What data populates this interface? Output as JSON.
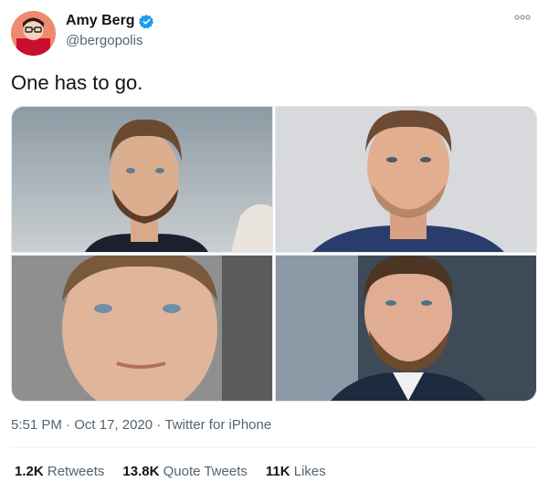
{
  "author": {
    "name": "Amy Berg",
    "handle": "@bergopolis",
    "verified_color": "#1d9bf0"
  },
  "tweet": {
    "text": "One has to go."
  },
  "photos": [
    {
      "label": "photo-1",
      "icon": "person-photo"
    },
    {
      "label": "photo-2",
      "icon": "person-photo"
    },
    {
      "label": "photo-3",
      "icon": "person-photo"
    },
    {
      "label": "photo-4",
      "icon": "person-photo"
    }
  ],
  "meta": {
    "time": "5:51 PM",
    "sep1": " · ",
    "date": "Oct 17, 2020",
    "sep2": " · ",
    "source": "Twitter for iPhone"
  },
  "stats": {
    "retweets_count": "1.2K",
    "retweets_label": "Retweets",
    "quotes_count": "13.8K",
    "quotes_label": "Quote Tweets",
    "likes_count": "11K",
    "likes_label": "Likes"
  },
  "colors": {
    "text": "#0f1419",
    "secondary": "#536471",
    "divider": "#eff3f4"
  }
}
